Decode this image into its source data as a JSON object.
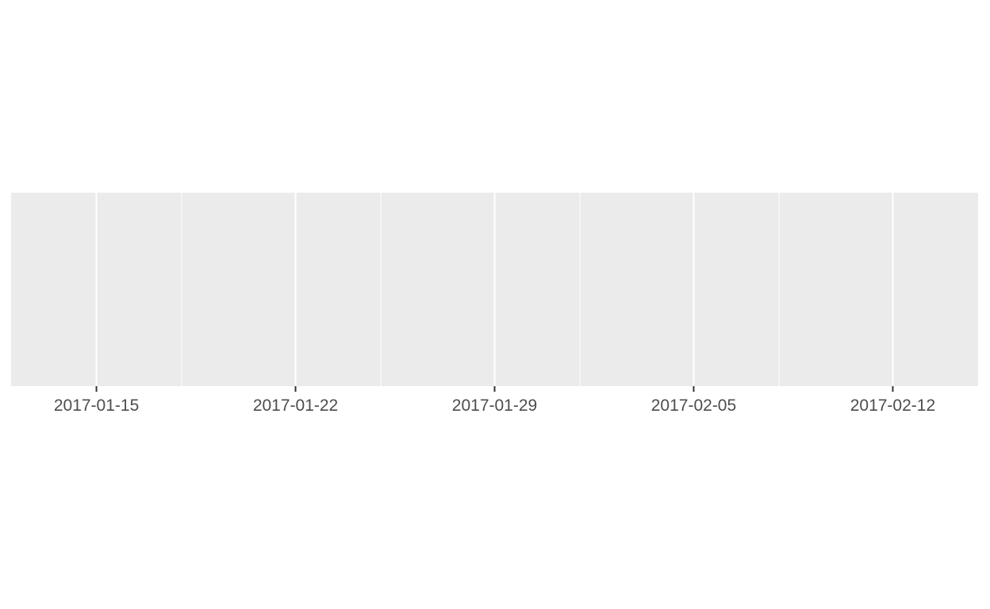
{
  "chart_data": {
    "type": "line",
    "title": "",
    "xlabel": "",
    "ylabel": "",
    "x_axis": {
      "type": "date",
      "range": [
        "2017-01-12",
        "2017-02-15"
      ],
      "major_ticks": [
        "2017-01-15",
        "2017-01-22",
        "2017-01-29",
        "2017-02-05",
        "2017-02-12"
      ],
      "minor_gridlines": [
        "2017-01-18",
        "2017-01-25",
        "2017-02-01",
        "2017-02-08"
      ]
    },
    "y_axis": {
      "visible": false
    },
    "series": [],
    "grid": true,
    "colors": {
      "panel_background": "#ebebeb",
      "gridline": "#ffffff",
      "tick": "#333333",
      "tick_label": "#4d4d4d"
    }
  }
}
